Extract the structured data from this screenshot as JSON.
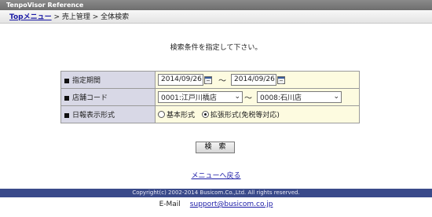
{
  "window": {
    "title": "TenpoVisor Reference"
  },
  "breadcrumb": {
    "top": "Topメニュー",
    "sep1": " > ",
    "section": "売上管理",
    "sep2": " > ",
    "page": "全体検索"
  },
  "instruction": "検索条件を指定して下さい。",
  "form": {
    "period": {
      "label": "指定期間",
      "from": "2014/09/26",
      "to": "2014/09/26",
      "sep": "～"
    },
    "store": {
      "label": "店舗コード",
      "from": "0001:江戸川橋店",
      "to": "0008:石川店",
      "sep": "～"
    },
    "format": {
      "label": "日報表示形式",
      "options": [
        {
          "label": "基本形式",
          "selected": false
        },
        {
          "label": "拡張形式(免税等対応)",
          "selected": true
        }
      ]
    }
  },
  "search_button": "検　索",
  "menu_link": "メニューへ戻る",
  "footer": {
    "copyright": "Copyright(c) 2002-2014 Busicom.Co.,Ltd.  All rights reserved.",
    "email_label": "E-Mail",
    "email": "support@busicom.co.jp"
  }
}
